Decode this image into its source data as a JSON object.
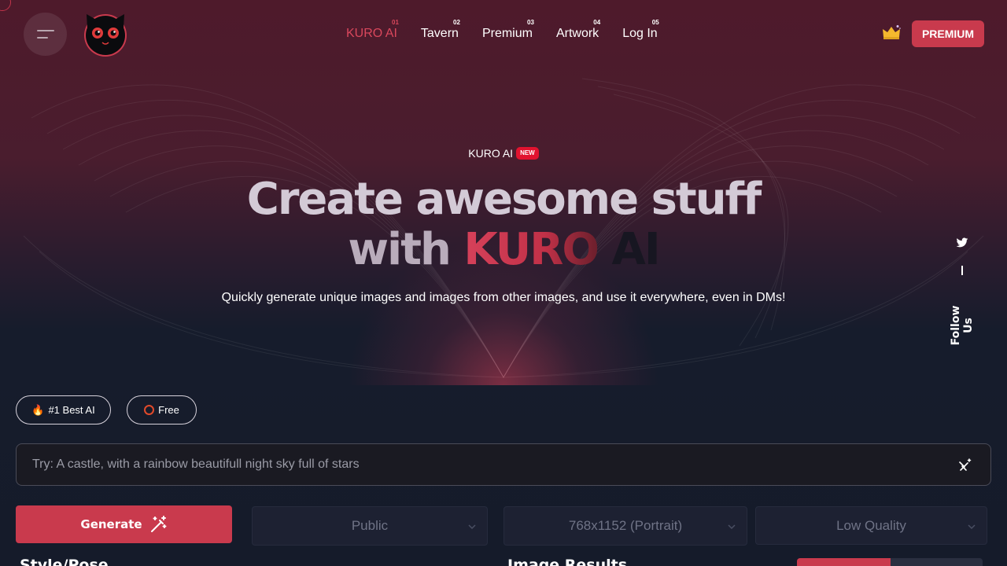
{
  "brand": {
    "logo": "black-cat-logo",
    "accent_color": "#c93a4d"
  },
  "nav": {
    "items": [
      {
        "num": "01",
        "label": "KURO AI",
        "active": true
      },
      {
        "num": "02",
        "label": "Tavern",
        "active": false
      },
      {
        "num": "03",
        "label": "Premium",
        "active": false
      },
      {
        "num": "04",
        "label": "Artwork",
        "active": false
      },
      {
        "num": "05",
        "label": "Log In",
        "active": false
      }
    ]
  },
  "header": {
    "premium_label": "PREMIUM",
    "crown_icon": "crown-icon",
    "menu_icon": "hamburger-icon"
  },
  "hero": {
    "tagline": "KURO AI",
    "badge": "NEW",
    "title_line1": "Create awesome stuff",
    "title_with": "with",
    "title_kuro": "KURO",
    "title_ai": "AI",
    "subtitle": "Quickly generate unique images and images from other images, and use it everywhere, even in DMs!"
  },
  "follow": {
    "label": "Follow Us",
    "icon": "twitter-icon"
  },
  "chips": {
    "best_emoji": "🔥",
    "best_label": "#1 Best AI",
    "free_icon": "ring-icon",
    "free_label": "Free"
  },
  "prompt": {
    "placeholder": "Try: A castle, with a rainbow beautifull night sky full of stars",
    "value": ""
  },
  "controls": {
    "generate_label": "Generate",
    "visibility": "Public",
    "size": "768x1152 (Portrait)",
    "quality": "Low Quality"
  },
  "sections": {
    "style": "Style/Pose",
    "results": "Image Results"
  }
}
